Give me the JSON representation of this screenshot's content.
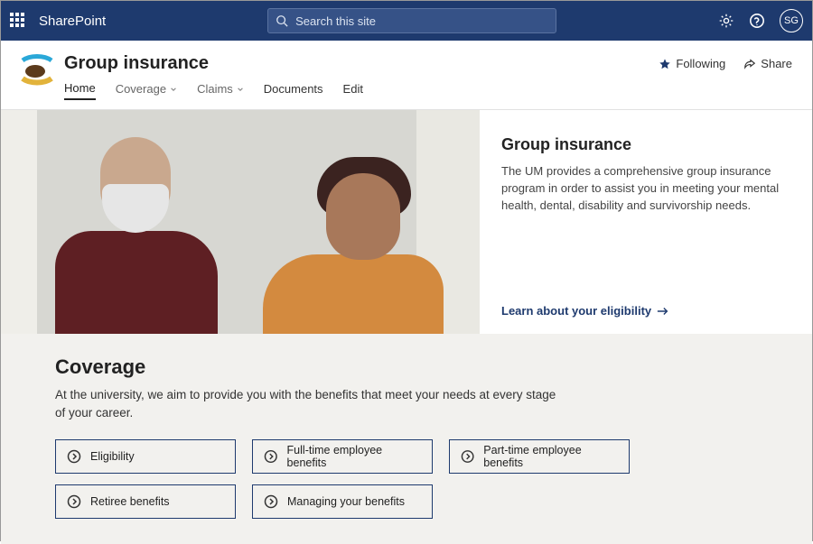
{
  "suite": {
    "brand": "SharePoint",
    "search_placeholder": "Search this site",
    "avatar_initials": "SG"
  },
  "site": {
    "title": "Group insurance",
    "nav": {
      "home": "Home",
      "coverage": "Coverage",
      "claims": "Claims",
      "documents": "Documents",
      "edit": "Edit"
    },
    "actions": {
      "following": "Following",
      "share": "Share"
    }
  },
  "hero": {
    "title": "Group insurance",
    "body": "The UM provides a comprehensive group insurance program in order to assist you in meeting your mental health, dental, disability and survivorship needs.",
    "link": "Learn about your eligibility"
  },
  "coverage": {
    "title": "Coverage",
    "subtitle": "At the university, we aim to provide you with the benefits that meet your needs at every stage of your career.",
    "cards": [
      "Eligibility",
      "Full-time employee benefits",
      "Part-time employee benefits",
      "Retiree benefits",
      "Managing your benefits"
    ]
  }
}
